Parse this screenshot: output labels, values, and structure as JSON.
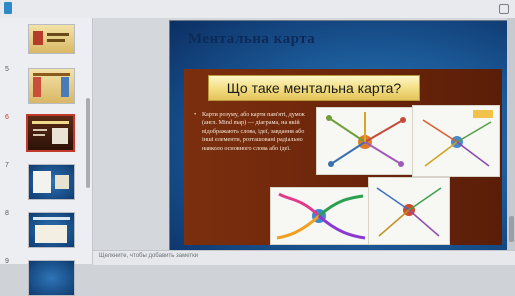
{
  "thumbnails": [
    {
      "number": "5"
    },
    {
      "number": "6"
    },
    {
      "number": "7"
    },
    {
      "number": "8"
    },
    {
      "number": "9"
    }
  ],
  "slide": {
    "title": "Ментальна карта",
    "banner": "Що таке ментальна карта?",
    "bullet_marker": "•",
    "bullet": "Карти розуму, або карти пам'яті, думок (англ. Mind map) — діаграма, на якій відображають слова, ідеї, завдання або інші елементи, розташовані радіально навколо основного слова або ідеї."
  },
  "notes": {
    "placeholder": "Щелкните, чтобы добавить заметки"
  },
  "colors": {
    "selected_border": "#c0392b",
    "slide_panel": "#6a240a",
    "banner_gold": "#f3df85"
  }
}
